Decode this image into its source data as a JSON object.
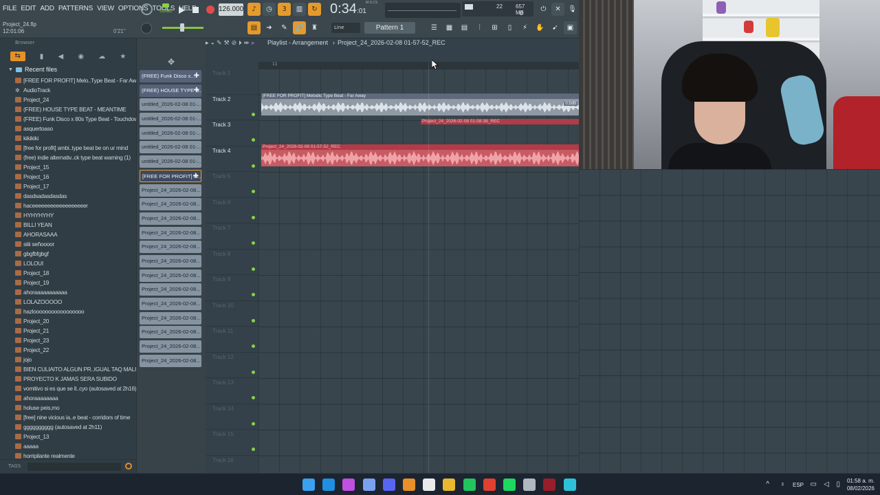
{
  "menu": [
    "FILE",
    "EDIT",
    "ADD",
    "PATTERNS",
    "VIEW",
    "OPTIONS",
    "TOOLS",
    "HELP"
  ],
  "project": {
    "file": "Project_24.flp",
    "time": "12:01:06",
    "duration": "0'21\""
  },
  "transport": {
    "song_label": "SONG",
    "tempo": "126.000",
    "clock_main": "0:34",
    "clock_sub": ":01",
    "clock_unit": "M:S:CS"
  },
  "performance": {
    "cpu": "22",
    "memory": "657 MB",
    "polyphony": "0"
  },
  "pattern_selector": "Pattern 1",
  "snap_mode": "Line",
  "browser": {
    "title": "Browser",
    "section": "Recent files",
    "files": [
      {
        "name": "[FREE FOR PROFIT] Melo..Type Beat - Far Away",
        "icon": "project"
      },
      {
        "name": "AudioTrack",
        "icon": "audio"
      },
      {
        "name": "Project_24",
        "icon": "project"
      },
      {
        "name": "(FREE) HOUSE TYPE BEAT - MEANTIME",
        "icon": "project"
      },
      {
        "name": "(FREE) Funk Disco x 80s Type Beat - Touchdown",
        "icon": "project"
      },
      {
        "name": "asquertoaso",
        "icon": "project"
      },
      {
        "name": "kikikiki",
        "icon": "project"
      },
      {
        "name": "[free for profit] ambi..type beat be on ur mind",
        "icon": "project"
      },
      {
        "name": "(free) indie  alternativ..ck type beat warning (1)",
        "icon": "project"
      },
      {
        "name": "Project_15",
        "icon": "project"
      },
      {
        "name": "Project_16",
        "icon": "project"
      },
      {
        "name": "Project_17",
        "icon": "project"
      },
      {
        "name": "dasdsadasdasdas",
        "icon": "project"
      },
      {
        "name": "haceeeeeeeeeeeeeeeeeer",
        "icon": "project"
      },
      {
        "name": "HYHYHYHY",
        "icon": "project"
      },
      {
        "name": "BILLI YEAN",
        "icon": "project"
      },
      {
        "name": "AHORASAAA",
        "icon": "project"
      },
      {
        "name": "siiii señoooor",
        "icon": "project"
      },
      {
        "name": "gbgfbfgbgf",
        "icon": "project"
      },
      {
        "name": "LOLOUI",
        "icon": "project"
      },
      {
        "name": "Project_18",
        "icon": "project"
      },
      {
        "name": "Project_19",
        "icon": "project"
      },
      {
        "name": "ahoraaaaaaaaaaa",
        "icon": "project"
      },
      {
        "name": "LOLAZOOOOO",
        "icon": "project"
      },
      {
        "name": "hazlooooooooooooooooo",
        "icon": "project"
      },
      {
        "name": "Project_20",
        "icon": "project"
      },
      {
        "name": "Project_21",
        "icon": "project"
      },
      {
        "name": "Project_23",
        "icon": "project"
      },
      {
        "name": "Project_22",
        "icon": "project"
      },
      {
        "name": "jojo",
        "icon": "project"
      },
      {
        "name": "BIEN CULIAITO ALGUN PR..IGUAL TAQ MALITO SI",
        "icon": "project"
      },
      {
        "name": "PROYECTO K JAMAS SERA SUBIDO",
        "icon": "project"
      },
      {
        "name": "vomitivo si es que se ll..cyo (autosaved at 2h16)",
        "icon": "project"
      },
      {
        "name": "ahoraaaaaaaa",
        "icon": "project"
      },
      {
        "name": "holuse peis,mo",
        "icon": "project"
      },
      {
        "name": "[free] nine vicious  ia..e beat - corridors of time",
        "icon": "project"
      },
      {
        "name": "gggggggggg (autosaved at 2h11)",
        "icon": "project"
      },
      {
        "name": "Project_13",
        "icon": "project"
      },
      {
        "name": "aaaaa",
        "icon": "project"
      },
      {
        "name": "horripilante realmente",
        "icon": "project"
      }
    ],
    "tags_label": "TAGS"
  },
  "picker": {
    "clips": [
      {
        "name": "(FREE) Funk Disco x...",
        "style": "dark",
        "plus": true
      },
      {
        "name": "(FREE) HOUSE TYPE B...",
        "style": "dark",
        "plus": true
      },
      {
        "name": "untitled_2026-02-08 01-...",
        "style": "gray",
        "plus": false
      },
      {
        "name": "untitled_2026-02-08 01-...",
        "style": "gray",
        "plus": false
      },
      {
        "name": "untitled_2026-02-08 01-...",
        "style": "gray",
        "plus": false
      },
      {
        "name": "untitled_2026-02-08 01-...",
        "style": "gray",
        "plus": false
      },
      {
        "name": "untitled_2026-02-08 01-...",
        "style": "gray",
        "plus": false
      },
      {
        "name": "[FREE FOR PROFIT] M...",
        "style": "hl",
        "plus": true
      },
      {
        "name": "Project_24_2026-02-08...",
        "style": "gray",
        "plus": false
      },
      {
        "name": "Project_24_2026-02-08...",
        "style": "gray",
        "plus": false
      },
      {
        "name": "Project_24_2026-02-08...",
        "style": "gray",
        "plus": false
      },
      {
        "name": "Project_24_2026-02-08...",
        "style": "gray",
        "plus": false
      },
      {
        "name": "Project_24_2026-02-08...",
        "style": "gray",
        "plus": false
      },
      {
        "name": "Project_24_2026-02-08...",
        "style": "gray",
        "plus": false
      },
      {
        "name": "Project_24_2026-02-08...",
        "style": "gray",
        "plus": false
      },
      {
        "name": "Project_24_2026-02-08...",
        "style": "gray",
        "plus": false
      },
      {
        "name": "Project_24_2026-02-08...",
        "style": "gray",
        "plus": false
      },
      {
        "name": "Project_24_2026-02-08...",
        "style": "gray",
        "plus": false
      },
      {
        "name": "Project_24_2026-02-08...",
        "style": "gray",
        "plus": false
      },
      {
        "name": "Project_24_2026-02-08...",
        "style": "gray",
        "plus": false
      },
      {
        "name": "Project_24_2026-02-08...",
        "style": "gray",
        "plus": false
      }
    ]
  },
  "playlist": {
    "title": "Playlist - Arrangement",
    "separator": "›",
    "active_clip": "Project_24_2026-02-08 01-57-52_REC",
    "bar_marker": "11",
    "tracks": [
      {
        "name": "Track 1",
        "active": false,
        "led": false
      },
      {
        "name": "Track 2",
        "active": true,
        "led": true
      },
      {
        "name": "Track 3",
        "active": true,
        "led": true
      },
      {
        "name": "Track 4",
        "active": true,
        "led": true
      },
      {
        "name": "Track 5",
        "active": false,
        "led": true
      },
      {
        "name": "Track 6",
        "active": false,
        "led": true
      },
      {
        "name": "Track 7",
        "active": false,
        "led": true
      },
      {
        "name": "Track 8",
        "active": false,
        "led": true
      },
      {
        "name": "Track 9",
        "active": false,
        "led": true
      },
      {
        "name": "Track 10",
        "active": false,
        "led": true
      },
      {
        "name": "Track 11",
        "active": false,
        "led": true
      },
      {
        "name": "Track 12",
        "active": false,
        "led": true
      },
      {
        "name": "Track 13",
        "active": false,
        "led": true
      },
      {
        "name": "Track 14",
        "active": false,
        "led": true
      },
      {
        "name": "Track 15",
        "active": false,
        "led": true
      },
      {
        "name": "Track 16",
        "active": false,
        "led": true
      }
    ],
    "clips": {
      "track2": {
        "label": "[FREE FOR PROFIT] Melodic Type Beat - Far Away",
        "gain": "0.5dB"
      },
      "track3": {
        "label": "Project_24_2026-02-08 01-58-38_REC"
      },
      "track4": {
        "label": "Project_24_2026-02-08 01-57-52_REC"
      }
    }
  },
  "taskbar": {
    "apps": [
      "windows-start",
      "edge",
      "copilot",
      "devhome",
      "discord",
      "fl-studio",
      "file",
      "explorer",
      "app-green",
      "chrome",
      "spotify",
      "settings",
      "obs",
      "notepad"
    ],
    "language": "ESP",
    "time": "01:58 a. m.",
    "date": "08/02/2026"
  },
  "colors": {
    "accent": "#e59a2c",
    "clip_red": "#c75b63",
    "clip_gray": "#8f9aa5",
    "led_green": "#8ad14a"
  }
}
